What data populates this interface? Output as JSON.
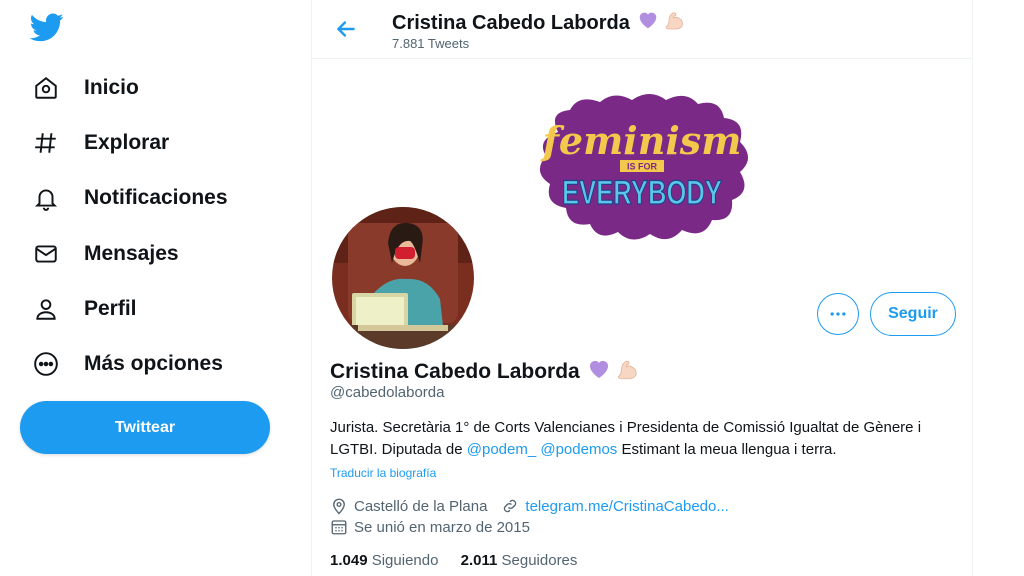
{
  "sidebar": {
    "logo_icon": "twitter-bird-icon",
    "items": [
      {
        "label": "Inicio",
        "icon": "home-icon"
      },
      {
        "label": "Explorar",
        "icon": "hashtag-icon"
      },
      {
        "label": "Notificaciones",
        "icon": "bell-icon"
      },
      {
        "label": "Mensajes",
        "icon": "mail-icon"
      },
      {
        "label": "Perfil",
        "icon": "person-icon"
      },
      {
        "label": "Más opciones",
        "icon": "more-circle-icon"
      }
    ],
    "tweet_button": "Twittear"
  },
  "header": {
    "name": "Cristina Cabedo Laborda",
    "tweet_count": "7.881 Tweets"
  },
  "banner": {
    "line1": "feminism",
    "line2": "IS FOR",
    "line3": "EVERYBODY",
    "bg_color": "#7a2a86",
    "text_color": "#f2c94c",
    "accent_color": "#5bc6e8"
  },
  "profile": {
    "name": "Cristina Cabedo Laborda",
    "handle": "@cabedolaborda",
    "follow_label": "Seguir",
    "bio_text": "Jurista. Secretària 1° de Corts Valencianes i Presidenta de Comissió Igualtat de Gènere i LGTBI. Diputada de ",
    "bio_link1": "@podem_",
    "bio_link2": "@podemos",
    "bio_tail": " Estimant la meua llengua i terra.",
    "translate_label": "Traducir la biografía",
    "location": "Castelló de la Plana",
    "website": "telegram.me/CristinaCabedo...",
    "joined": "Se unió en marzo de 2015",
    "following_count": "1.049",
    "following_label": "Siguiendo",
    "followers_count": "2.011",
    "followers_label": "Seguidores"
  },
  "colors": {
    "accent": "#1d9bf0",
    "heart": "#b18ee0",
    "text_secondary": "#536471"
  }
}
